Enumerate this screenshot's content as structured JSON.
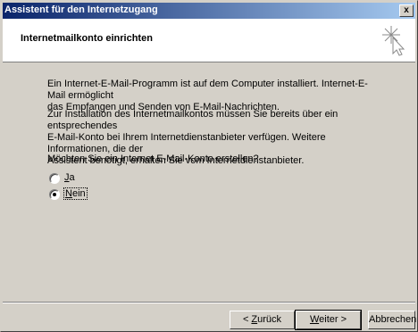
{
  "window": {
    "title": "Assistent für den Internetzugang",
    "close_label": "x"
  },
  "header": {
    "title": "Internetmailkonto einrichten",
    "icon": "wizard-sparkle-cursor-icon"
  },
  "content": {
    "para1_line1": "Ein Internet-E-Mail-Programm ist auf dem Computer installiert. Internet-E-Mail ermöglicht",
    "para1_line2": "das Empfangen und Senden von E-Mail-Nachrichten.",
    "para2_line1": "Zur Installation des Internetmailkontos müssen Sie bereits über ein entsprechendes",
    "para2_line2": "E-Mail-Konto bei Ihrem Internetdienstanbieter verfügen. Weitere Informationen, die der",
    "para2_line3": "Assistent benötigt, erhalten Sie vom Internetdienstanbieter.",
    "question": "Möchten Sie ein Internet E-Mail-Konto erstellen?"
  },
  "options": {
    "yes": {
      "accel": "J",
      "rest": "a",
      "selected": false
    },
    "no": {
      "accel": "N",
      "rest": "ein",
      "selected": true
    }
  },
  "buttons": {
    "back_prefix": "< ",
    "back_accel": "Z",
    "back_rest": "urück",
    "next_accel": "W",
    "next_rest": "eiter >",
    "cancel": "Abbrechen"
  },
  "colors": {
    "titlebar_start": "#0a246a",
    "titlebar_end": "#a6caf0",
    "face": "#d4d0c8"
  }
}
